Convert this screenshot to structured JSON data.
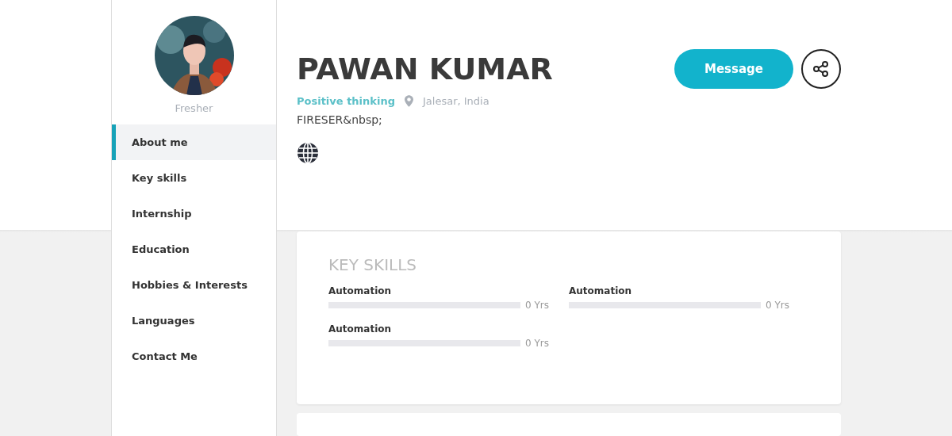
{
  "profile": {
    "status": "Fresher",
    "name": "PAWAN KUMAR",
    "tagline": "Positive thinking",
    "location": "Jalesar, India",
    "bio": "FIRESER&nbsp;"
  },
  "nav": [
    {
      "label": "About me",
      "selected": true
    },
    {
      "label": "Key skills",
      "selected": false
    },
    {
      "label": "Internship",
      "selected": false
    },
    {
      "label": "Education",
      "selected": false
    },
    {
      "label": "Hobbies & Interests",
      "selected": false
    },
    {
      "label": "Languages",
      "selected": false
    },
    {
      "label": "Contact Me",
      "selected": false
    }
  ],
  "actions": {
    "message": "Message"
  },
  "key_skills": {
    "title": "KEY SKILLS",
    "skills": [
      {
        "name": "Automation",
        "level": 0,
        "reading": "0 Yrs"
      },
      {
        "name": "Automation",
        "level": 0,
        "reading": "0 Yrs"
      },
      {
        "name": "Automation",
        "level": 0,
        "reading": "0 Yrs"
      }
    ]
  }
}
